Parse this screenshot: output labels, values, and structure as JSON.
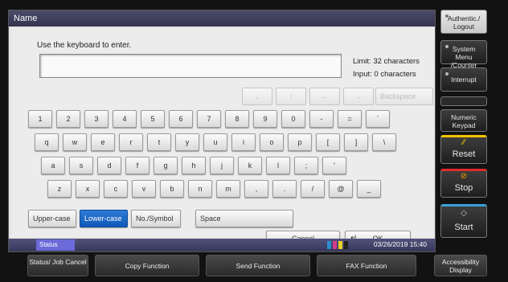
{
  "screen": {
    "title": "Name",
    "instruction": "Use the keyboard to enter.",
    "limit_text": "Limit: 32 characters",
    "input_count": "Input: 0 characters",
    "text_value": ""
  },
  "cursor_keys": [
    {
      "name": "arrow-down-key",
      "label": "↓"
    },
    {
      "name": "arrow-up-key",
      "label": "↑"
    },
    {
      "name": "arrow-left-key",
      "label": "←"
    },
    {
      "name": "arrow-right-key",
      "label": "→"
    },
    {
      "name": "backspace-key",
      "label": "Backspace"
    }
  ],
  "keyboard": {
    "row1": [
      "1",
      "2",
      "3",
      "4",
      "5",
      "6",
      "7",
      "8",
      "9",
      "0",
      "-",
      "=",
      "`"
    ],
    "row2": [
      "q",
      "w",
      "e",
      "r",
      "t",
      "y",
      "u",
      "i",
      "o",
      "p",
      "[",
      "]",
      "\\"
    ],
    "row3": [
      "a",
      "s",
      "d",
      "f",
      "g",
      "h",
      "j",
      "k",
      "l",
      ";",
      "'"
    ],
    "row4": [
      "z",
      "x",
      "c",
      "v",
      "b",
      "n",
      "m",
      ",",
      ".",
      "/",
      "@",
      "_"
    ]
  },
  "mode_keys": {
    "upper": "Upper-case",
    "lower": "Lower-case",
    "symbol": "No./Symbol",
    "space": "Space",
    "active": "lower"
  },
  "actions": {
    "cancel": "Cancel",
    "ok": "OK"
  },
  "status_bar": {
    "label": "Status",
    "datetime": "03/26/2019 15:40"
  },
  "side_panel": {
    "authentic": "Authentic./ Logout",
    "system_menu": "System Menu /Counter",
    "interrupt": "Interrupt",
    "numeric": "Numeric Keypad",
    "reset": "Reset",
    "stop": "Stop",
    "start": "Start"
  },
  "bottom_bar": {
    "status_job": "Status/ Job Cancel",
    "copy": "Copy Function",
    "send": "Send Function",
    "fax": "FAX Function",
    "accessibility": "Accessibility Display"
  },
  "colors": {
    "active_key": "#1a66c8",
    "reset_accent": "#f2c500",
    "stop_accent": "#e02a2a",
    "start_accent": "#3aa0d8"
  }
}
